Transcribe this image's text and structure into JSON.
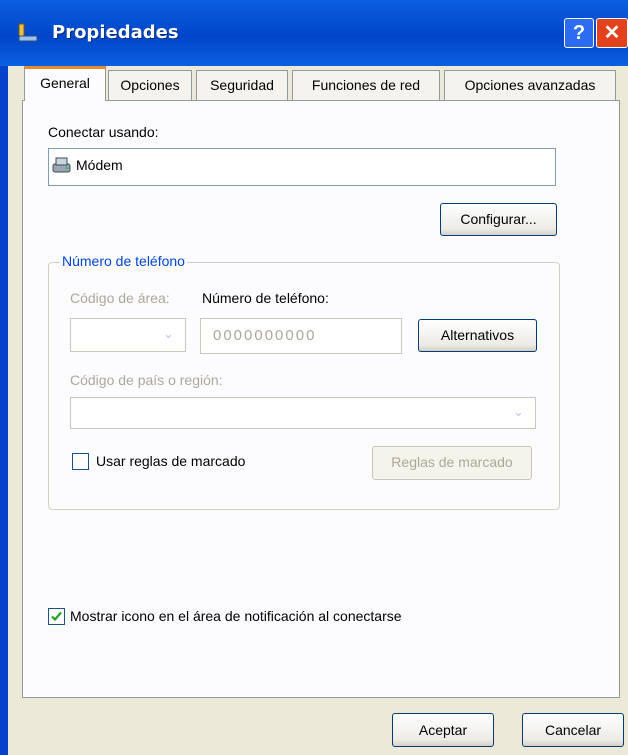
{
  "window": {
    "title": "Propiedades",
    "help_glyph": "?",
    "close_glyph": "✕"
  },
  "tabs": [
    {
      "label": "General",
      "active": true
    },
    {
      "label": "Opciones",
      "active": false
    },
    {
      "label": "Seguridad",
      "active": false
    },
    {
      "label": "Funciones de red",
      "active": false
    },
    {
      "label": "Opciones avanzadas",
      "active": false
    }
  ],
  "general": {
    "connect_using_label": "Conectar usando:",
    "device_name": "Módem",
    "configure_button": "Configurar..."
  },
  "phone_group": {
    "title": "Número de teléfono",
    "area_code_label": "Código de área:",
    "area_code_value": "",
    "phone_label": "Número de teléfono:",
    "phone_value": "0000000000",
    "alternates_button": "Alternativos",
    "country_label": "Código de país o región:",
    "country_value": "",
    "dialing_rules_checkbox": "Usar reglas de marcado",
    "dialing_rules_checked": false,
    "dialing_rules_button": "Reglas de marcado"
  },
  "show_icon": {
    "label": "Mostrar icono en el área de notificación al conectarse",
    "checked": true
  },
  "footer": {
    "ok_button": "Aceptar",
    "cancel_button": "Cancelar"
  },
  "colors": {
    "title_bar": "#0a5fe0",
    "group_title": "#0046d5",
    "tab_highlight": "#e68b2c"
  }
}
